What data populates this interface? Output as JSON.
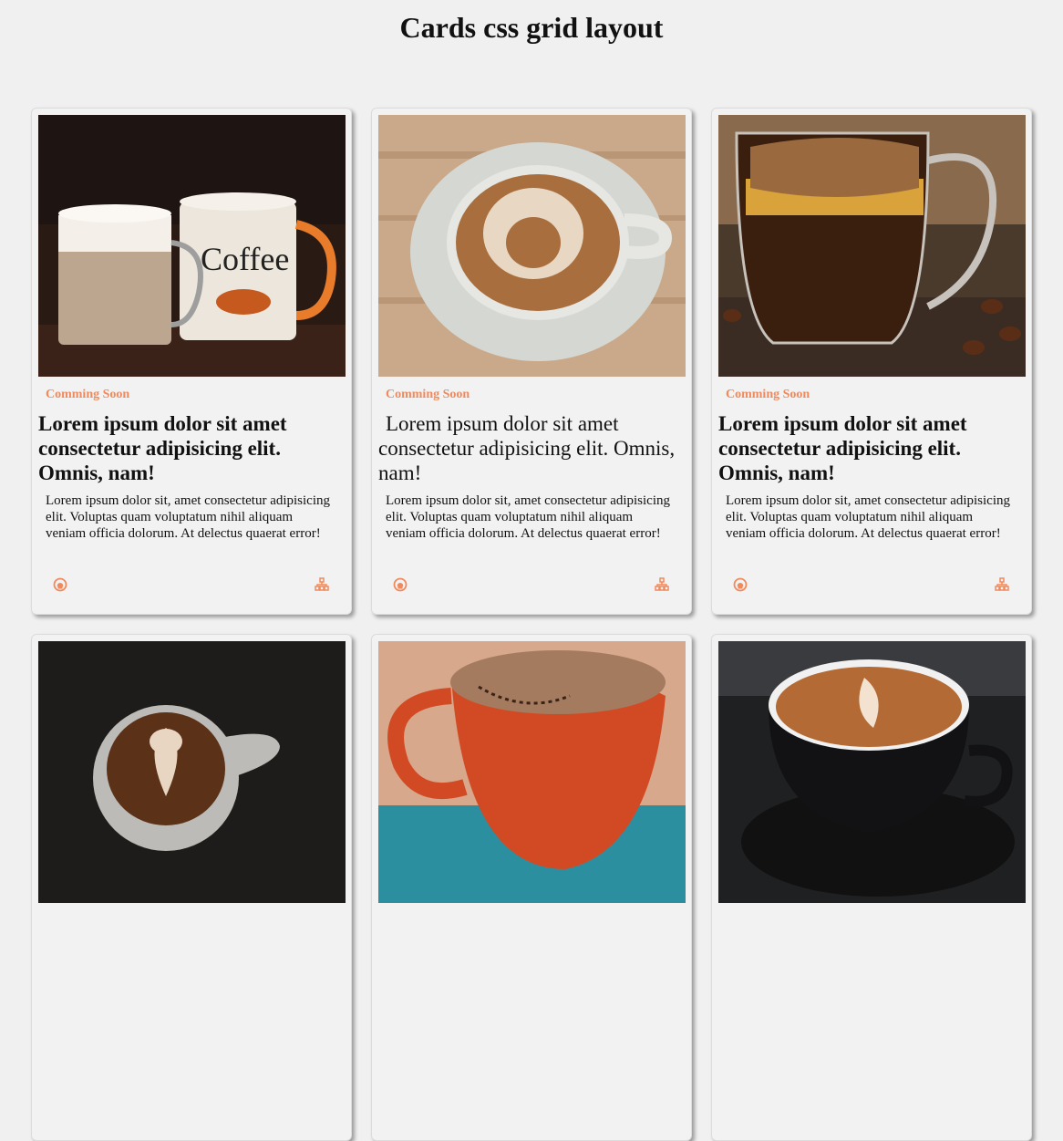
{
  "page": {
    "title": "Cards css grid layout"
  },
  "colors": {
    "accent": "#f08a5d",
    "background": "#f1f0f0"
  },
  "cards": [
    {
      "tag": "Comming Soon",
      "title": "Lorem ipsum dolor sit amet consectetur adipisicing elit. Omnis, nam!",
      "body": "Lorem ipsum dolor sit, amet consectetur adipisicing elit. Voluptas quam voluptatum nihil aliquam veniam officia dolorum. At delectus quaerat error!",
      "left_icon": "github-icon",
      "right_icon": "sitemap-icon"
    },
    {
      "tag": "Comming Soon",
      "title": "Lorem ipsum dolor sit amet consectetur adipisicing elit. Omnis, nam!",
      "body": "Lorem ipsum dolor sit, amet consectetur adipisicing elit. Voluptas quam voluptatum nihil aliquam veniam officia dolorum. At delectus quaerat error!",
      "left_icon": "github-icon",
      "right_icon": "sitemap-icon"
    },
    {
      "tag": "Comming Soon",
      "title": "Lorem ipsum dolor sit amet consectetur adipisicing elit. Omnis, nam!",
      "body": "Lorem ipsum dolor sit, amet consectetur adipisicing elit. Voluptas quam voluptatum nihil aliquam veniam officia dolorum. At delectus quaerat error!",
      "left_icon": "github-icon",
      "right_icon": "sitemap-icon"
    }
  ]
}
